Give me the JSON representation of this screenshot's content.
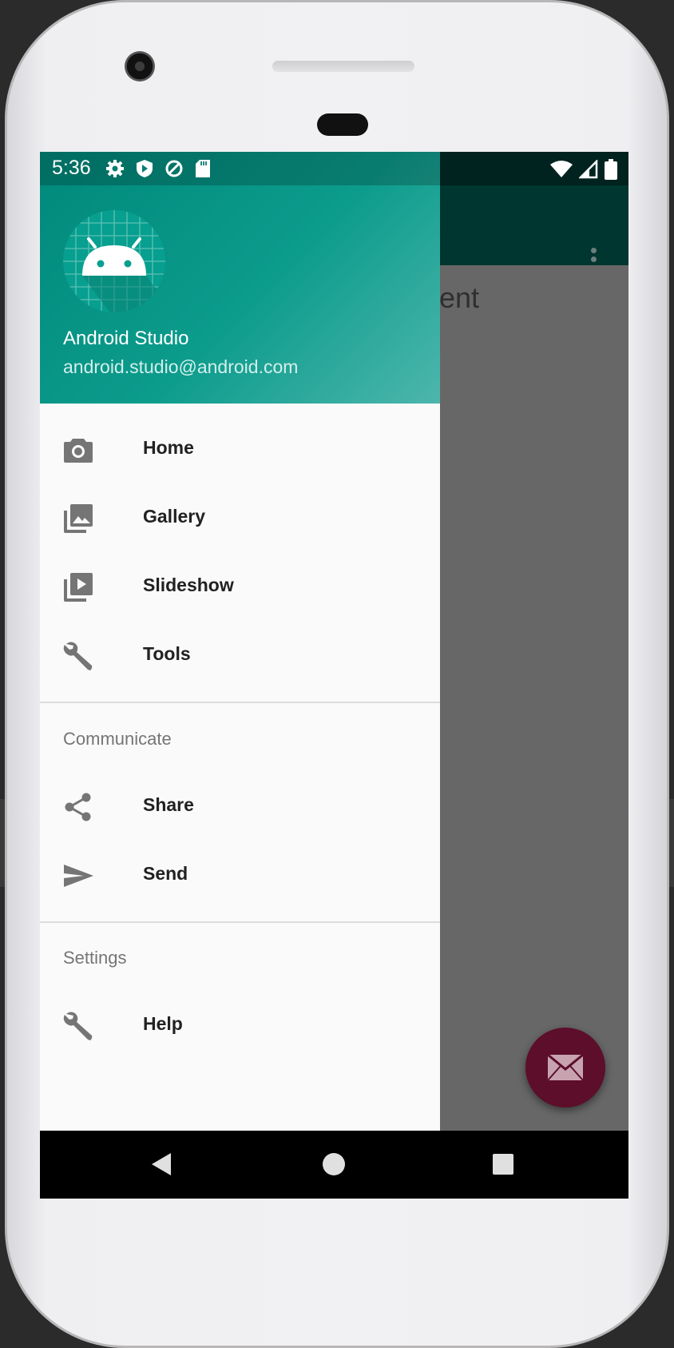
{
  "status_bar": {
    "time": "5:36"
  },
  "app": {
    "content_text": "ent"
  },
  "drawer": {
    "header": {
      "name": "Android Studio",
      "email": "android.studio@android.com"
    },
    "primary_items": [
      {
        "label": "Home",
        "icon": "camera-icon"
      },
      {
        "label": "Gallery",
        "icon": "gallery-icon"
      },
      {
        "label": "Slideshow",
        "icon": "slideshow-icon"
      },
      {
        "label": "Tools",
        "icon": "wrench-icon"
      }
    ],
    "communicate": {
      "title": "Communicate",
      "items": [
        {
          "label": "Share",
          "icon": "share-icon"
        },
        {
          "label": "Send",
          "icon": "send-icon"
        }
      ]
    },
    "settings": {
      "title": "Settings",
      "items": [
        {
          "label": "Help",
          "icon": "wrench-icon"
        }
      ]
    }
  },
  "colors": {
    "drawer_header": "#00897b",
    "fab": "#5c0e2a",
    "toolbar": "#003630",
    "scrim_content": "#676767"
  }
}
